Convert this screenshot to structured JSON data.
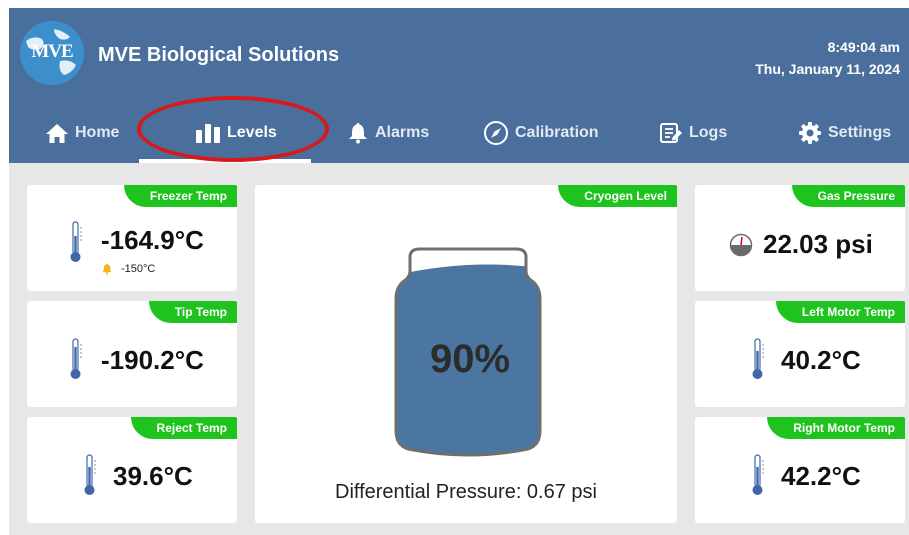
{
  "header": {
    "logo_text": "MVE",
    "app_title": "MVE Biological Solutions",
    "time": "8:49:04 am",
    "date": "Thu, January 11, 2024"
  },
  "nav": {
    "items": [
      {
        "label": "Home",
        "icon": "home-icon"
      },
      {
        "label": "Levels",
        "icon": "levels-icon",
        "active": true
      },
      {
        "label": "Alarms",
        "icon": "bell-icon"
      },
      {
        "label": "Calibration",
        "icon": "compass-icon"
      },
      {
        "label": "Logs",
        "icon": "logs-icon"
      },
      {
        "label": "Settings",
        "icon": "gear-icon"
      }
    ]
  },
  "cards": {
    "freezer_temp": {
      "title": "Freezer Temp",
      "value": "-164.9°C",
      "alarm": "-150°C"
    },
    "tip_temp": {
      "title": "Tip Temp",
      "value": "-190.2°C"
    },
    "reject_temp": {
      "title": "Reject Temp",
      "value": "39.6°C"
    },
    "cryogen_level": {
      "title": "Cryogen Level",
      "percent": "90%",
      "fill_fraction": 0.9,
      "differential_pressure": "Differential Pressure: 0.67 psi"
    },
    "gas_pressure": {
      "title": "Gas Pressure",
      "value": "22.03 psi"
    },
    "left_motor_temp": {
      "title": "Left Motor Temp",
      "value": "40.2°C"
    },
    "right_motor_temp": {
      "title": "Right Motor Temp",
      "value": "42.2°C"
    }
  },
  "colors": {
    "header_bg": "#4a6f9c",
    "tag_green": "#1ec31e",
    "tank_fill": "#4a76a1",
    "annotation_red": "#d7191c"
  }
}
